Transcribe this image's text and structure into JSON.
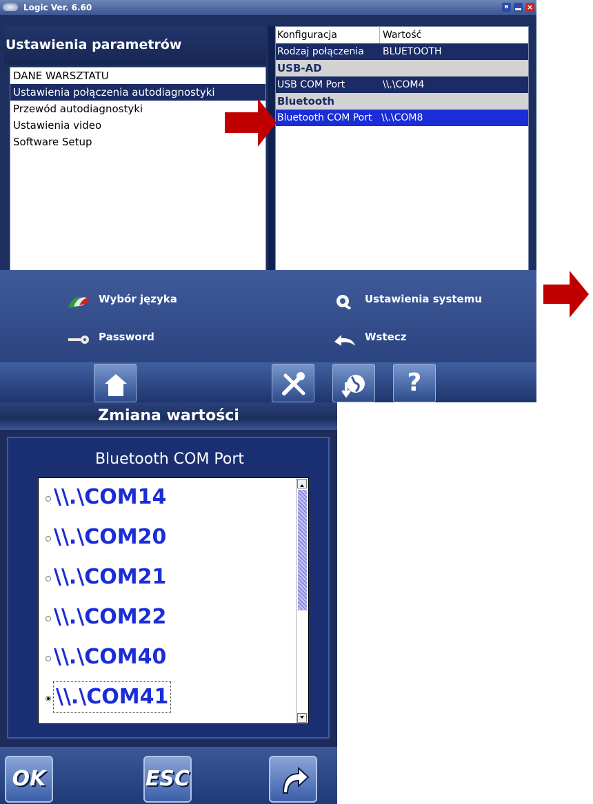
{
  "window": {
    "title": "Logic Ver. 6.60",
    "controls": {
      "bluetooth": "ʙ",
      "close": "×"
    }
  },
  "left_panel": {
    "title": "Ustawienia parametrów",
    "items": [
      {
        "label": "DANE WARSZTATU"
      },
      {
        "label": "Ustawienia połączenia autodiagnostyki"
      },
      {
        "label": "Przewód autodiagnostyki"
      },
      {
        "label": "Ustawienia video"
      },
      {
        "label": "Software Setup"
      }
    ],
    "selected_index": 1
  },
  "config_table": {
    "headers": [
      "Konfiguracja",
      "Wartość"
    ],
    "rows": [
      {
        "key": "Rodzaj połączenia",
        "value": "BLUETOOTH"
      },
      {
        "group": "USB-AD"
      },
      {
        "key": "USB COM Port",
        "value": "\\\\.\\COM4"
      },
      {
        "group": "Bluetooth"
      },
      {
        "key": "Bluetooth COM Port",
        "value": "\\\\.\\COM8"
      }
    ]
  },
  "menu": {
    "language": "Wybór języka",
    "system_settings": "Ustawienia systemu",
    "password": "Password",
    "back": "Wstecz"
  },
  "toolbar": {
    "help": "?"
  },
  "dialog": {
    "title": "Zmiana wartości",
    "field_label": "Bluetooth COM Port",
    "options": [
      "\\\\.\\COM14",
      "\\\\.\\COM20",
      "\\\\.\\COM21",
      "\\\\.\\COM22",
      "\\\\.\\COM40",
      "\\\\.\\COM41"
    ],
    "selected_option": "\\\\.\\COM41",
    "ok_label": "OK",
    "esc_label": "ESC"
  },
  "colors": {
    "arrow": "#c00000",
    "selection": "#1a2b66",
    "highlight": "#1a2dd6"
  }
}
